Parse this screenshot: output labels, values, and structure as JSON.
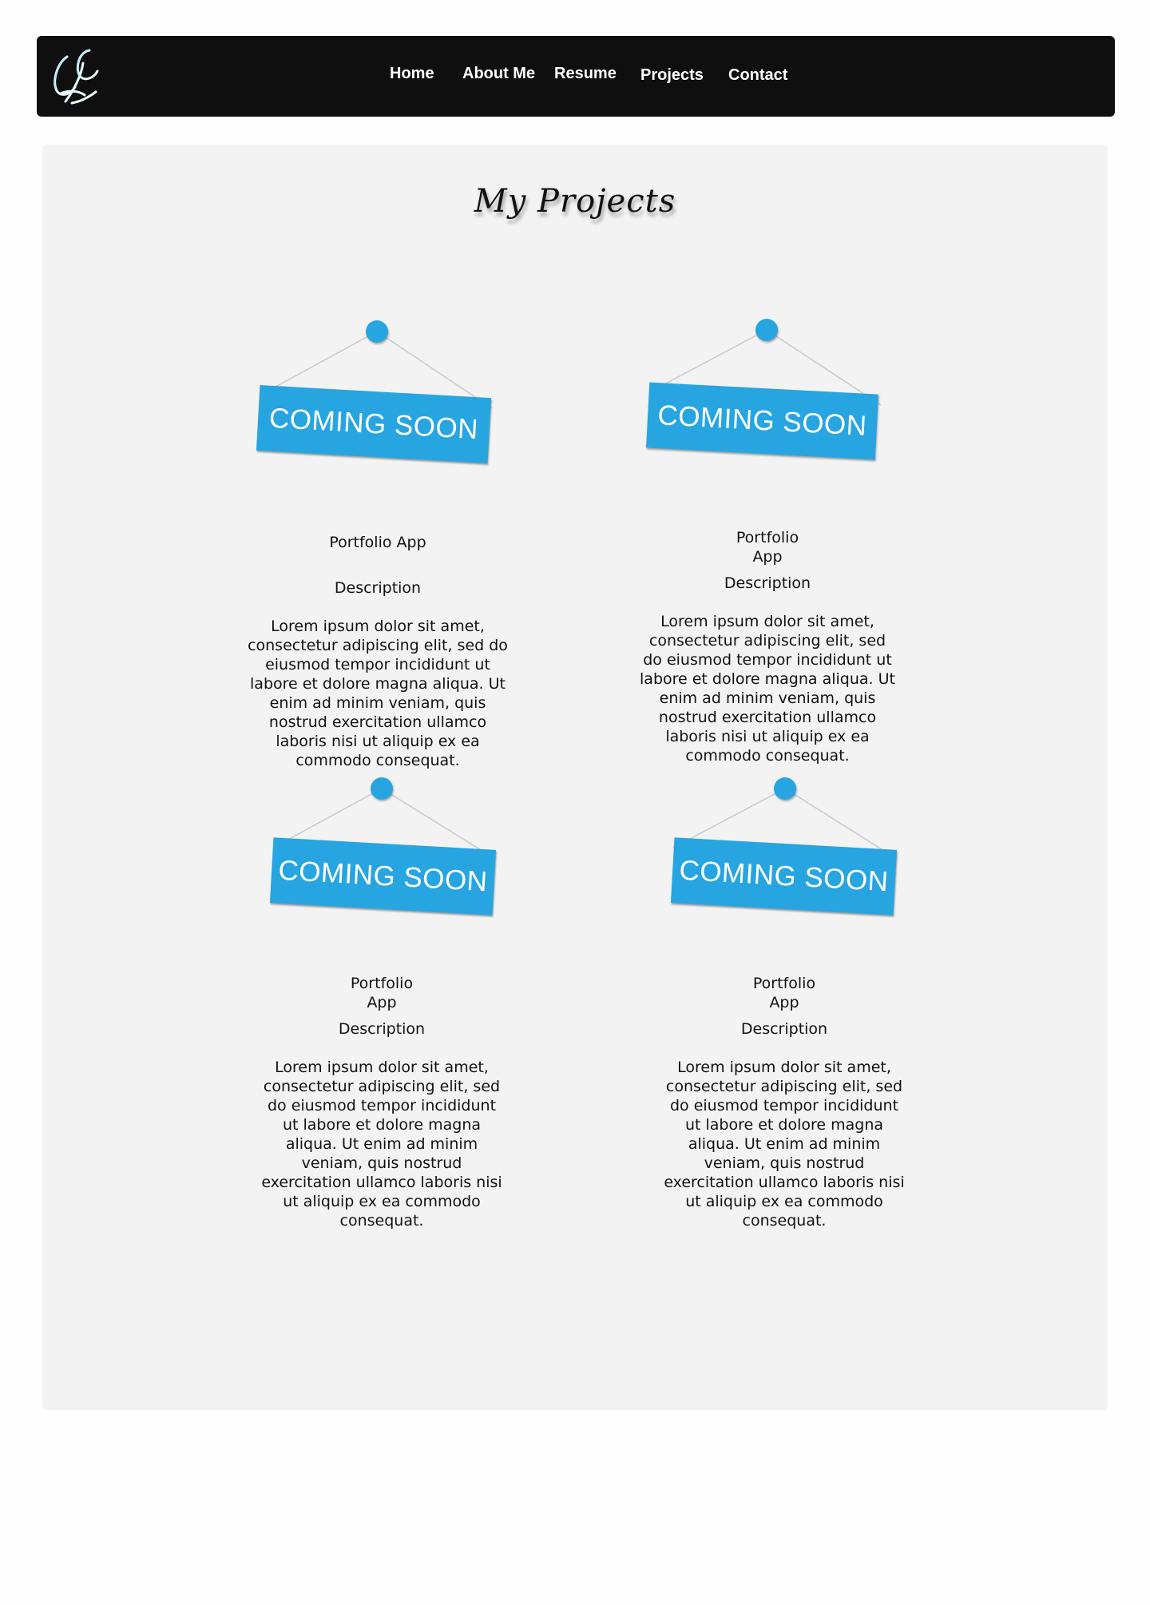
{
  "navbar": {
    "logo_text": "LC",
    "links": [
      "Home",
      "About Me",
      "Resume",
      "Projects",
      "Contact"
    ]
  },
  "page": {
    "title": "My Projects"
  },
  "projects": [
    {
      "sign_text": "COMING SOON",
      "name": "Portfolio App",
      "description_label": "Description",
      "description": "Lorem ipsum dolor sit amet, consectetur adipiscing elit, sed do eiusmod tempor incididunt ut labore et dolore magna aliqua. Ut enim ad minim veniam, quis nostrud exercitation ullamco laboris nisi ut aliquip ex ea commodo consequat."
    },
    {
      "sign_text": "COMING SOON",
      "name": "Portfolio App",
      "description_label": "Description",
      "description": "Lorem ipsum dolor sit amet, consectetur adipiscing elit, sed do eiusmod tempor incididunt ut labore et dolore magna aliqua. Ut enim ad minim veniam, quis nostrud exercitation ullamco laboris nisi ut aliquip ex ea commodo consequat."
    },
    {
      "sign_text": "COMING SOON",
      "name": "Portfolio App",
      "description_label": "Description",
      "description": "Lorem ipsum dolor sit amet, consectetur adipiscing elit, sed do eiusmod tempor incididunt ut labore et dolore magna aliqua. Ut enim ad minim veniam, quis nostrud exercitation ullamco laboris nisi ut aliquip ex ea commodo consequat."
    },
    {
      "sign_text": "COMING SOON",
      "name": "Portfolio App",
      "description_label": "Description",
      "description": "Lorem ipsum dolor sit amet, consectetur adipiscing elit, sed do eiusmod tempor incididunt ut labore et dolore magna aliqua. Ut enim ad minim veniam, quis nostrud exercitation ullamco laboris nisi ut aliquip ex ea commodo consequat."
    }
  ],
  "colors": {
    "navbar_bg": "#0f0f0f",
    "panel_bg": "#f3f3f3",
    "sign_blue": "#27a5e1"
  }
}
